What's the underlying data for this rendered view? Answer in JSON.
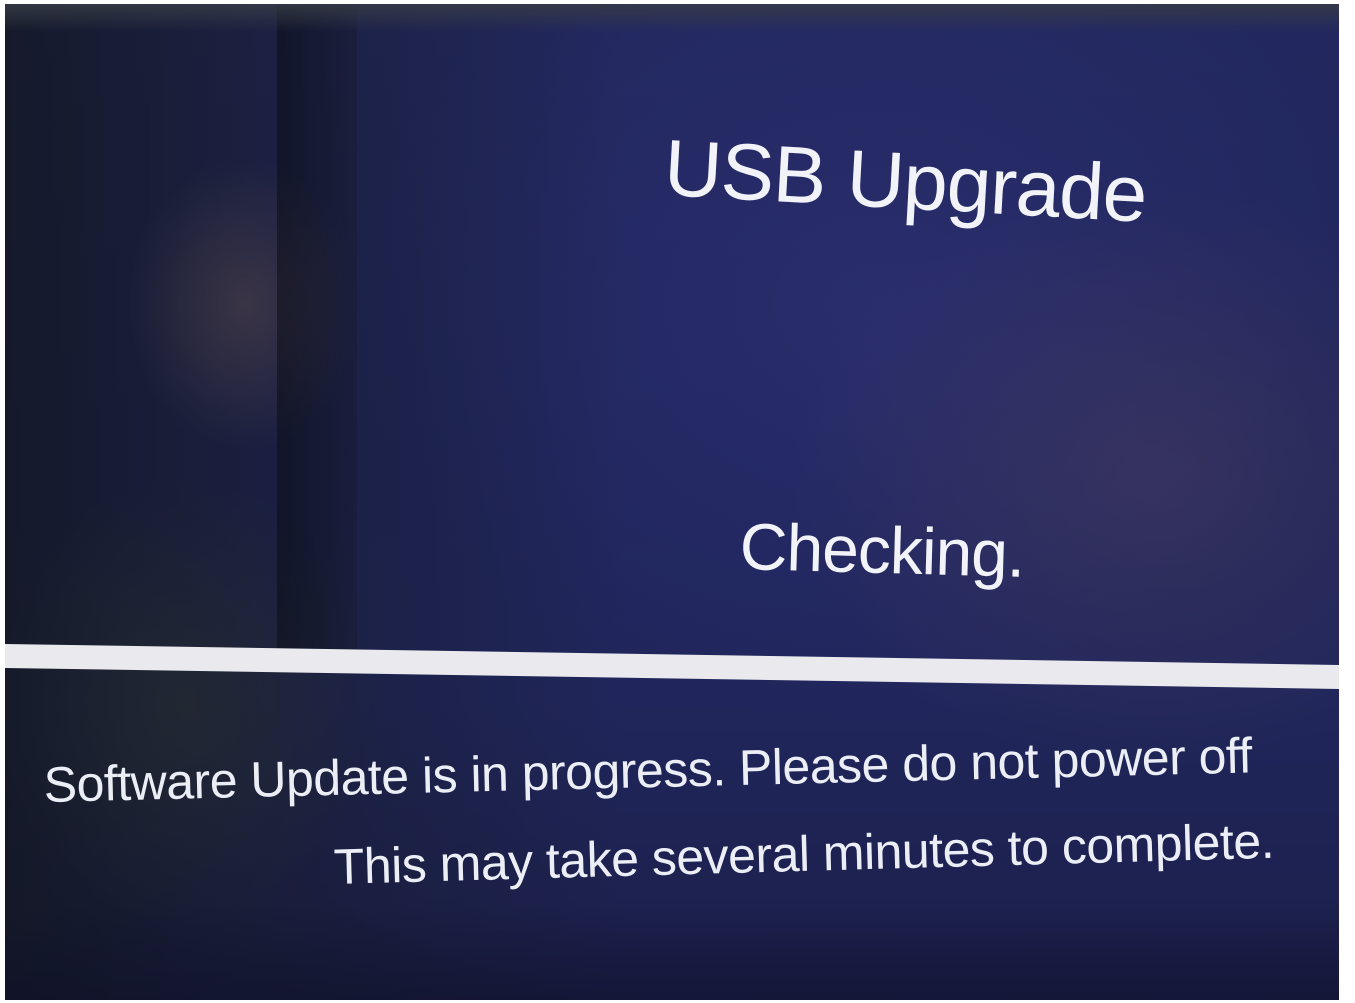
{
  "upgrade_screen": {
    "title": "USB Upgrade",
    "status": "Checking.",
    "progress": 1.0,
    "message_line_1": "Software Update is in progress. Please do not power off",
    "message_line_2": "This may take several minutes to complete."
  },
  "colors": {
    "background": "#1f255c",
    "text": "#f2f3f8",
    "progress_bar": "#e9e9ee"
  }
}
